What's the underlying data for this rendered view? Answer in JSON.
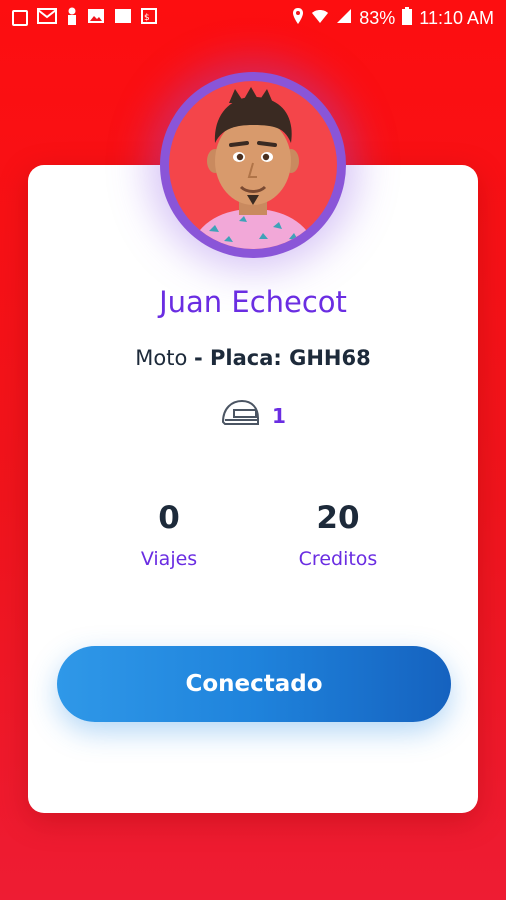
{
  "status_bar": {
    "battery": "83%",
    "time": "11:10 AM",
    "left_icons": [
      "notification-icon",
      "gmail-icon",
      "person-icon",
      "image-icon",
      "clapper-icon",
      "app-icon"
    ],
    "right_icons": [
      "location-icon",
      "wifi-icon",
      "signal-icon",
      "battery-icon"
    ]
  },
  "profile": {
    "name": "Juan Echecot",
    "vehicle_type": "Moto",
    "plate_label": "- Placa: GHH68",
    "helmets": "1"
  },
  "stats": {
    "trips_value": "0",
    "trips_label": "Viajes",
    "credits_value": "20",
    "credits_label": "Creditos"
  },
  "actions": {
    "connect_label": "Conectado"
  },
  "colors": {
    "background": "#fd0e10",
    "accent_purple": "#6a2de2",
    "button_blue": "#1f83dc",
    "text_dark": "#1d2a3a"
  }
}
